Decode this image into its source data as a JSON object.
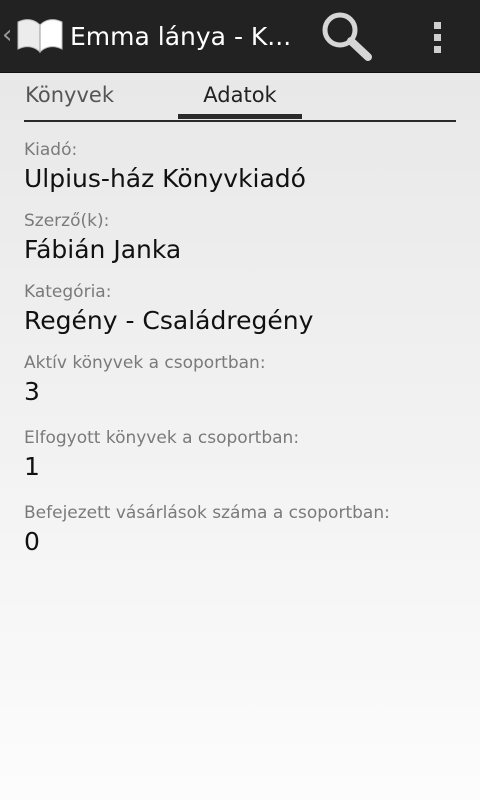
{
  "action_bar": {
    "title": "Emma lánya - K...",
    "back_icon": "chevron-left-icon",
    "app_icon": "open-book-icon",
    "search_icon": "search-icon",
    "overflow_icon": "overflow-menu-icon"
  },
  "tabs": [
    {
      "label": "Könyvek",
      "selected": false
    },
    {
      "label": "Adatok",
      "selected": true
    }
  ],
  "details": [
    {
      "label": "Kiadó:",
      "value": "Ulpius-ház Könyvkiadó"
    },
    {
      "label": "Szerző(k):",
      "value": "Fábián Janka"
    },
    {
      "label": "Kategória:",
      "value": "Regény - Családregény"
    },
    {
      "label": "Aktív könyvek a csoportban:",
      "value": "3"
    },
    {
      "label": "Elfogyott könyvek a csoportban:",
      "value": "1"
    },
    {
      "label": "Befejezett vásárlások száma a csoportban:",
      "value": "0"
    }
  ]
}
